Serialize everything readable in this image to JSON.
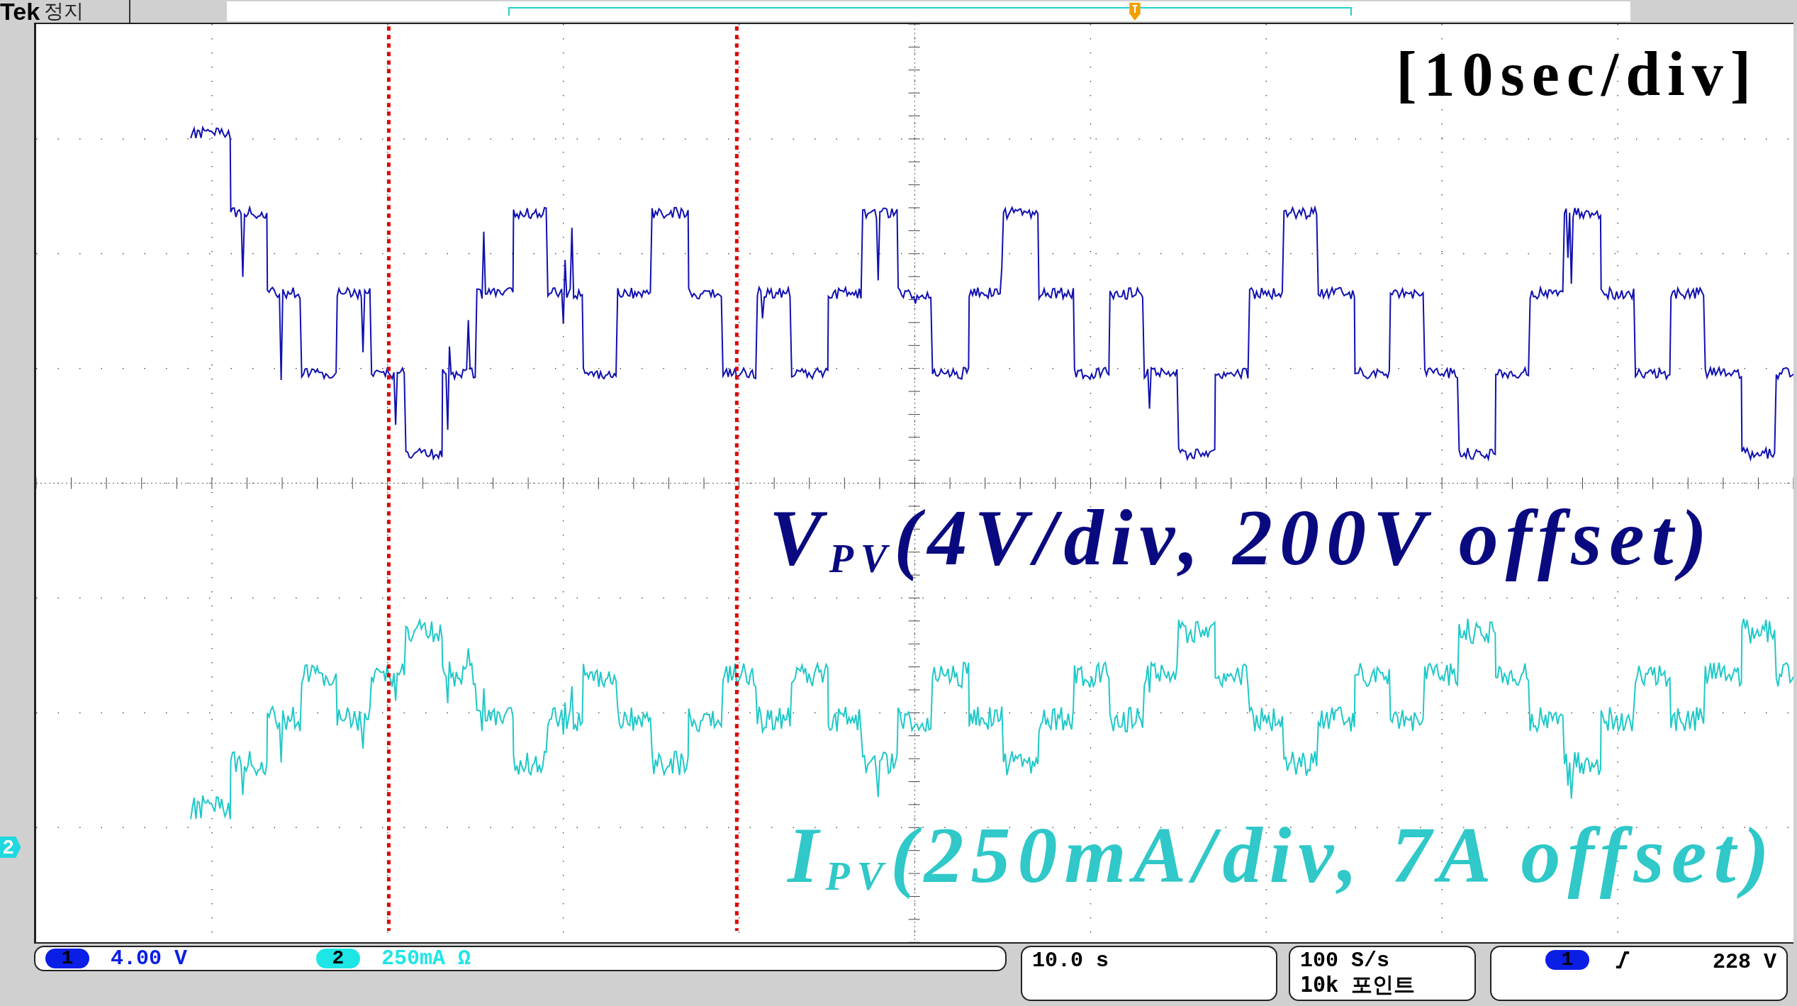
{
  "header": {
    "brand": "Tek",
    "status": "정지"
  },
  "channel_marker": "2",
  "annotations": {
    "timebase": "[10sec/div]",
    "ch1": "V$_{PV}$(4V/div, 200V offset)",
    "ch2": "I$_{PV}$(250mA/div, 7A offset)"
  },
  "status_bar": {
    "channels": [
      {
        "number": "1",
        "scale": "4.00 V",
        "color": "#0a1ee6"
      },
      {
        "number": "2",
        "scale": "250mA Ω",
        "color": "#1ee6e6"
      }
    ],
    "timebase": "10.0 s",
    "sample_rate": "100 S/s",
    "record_length": "10k 포인트",
    "trigger": {
      "source": "1",
      "level": "228 V",
      "color": "#0a1ee6"
    }
  }
}
